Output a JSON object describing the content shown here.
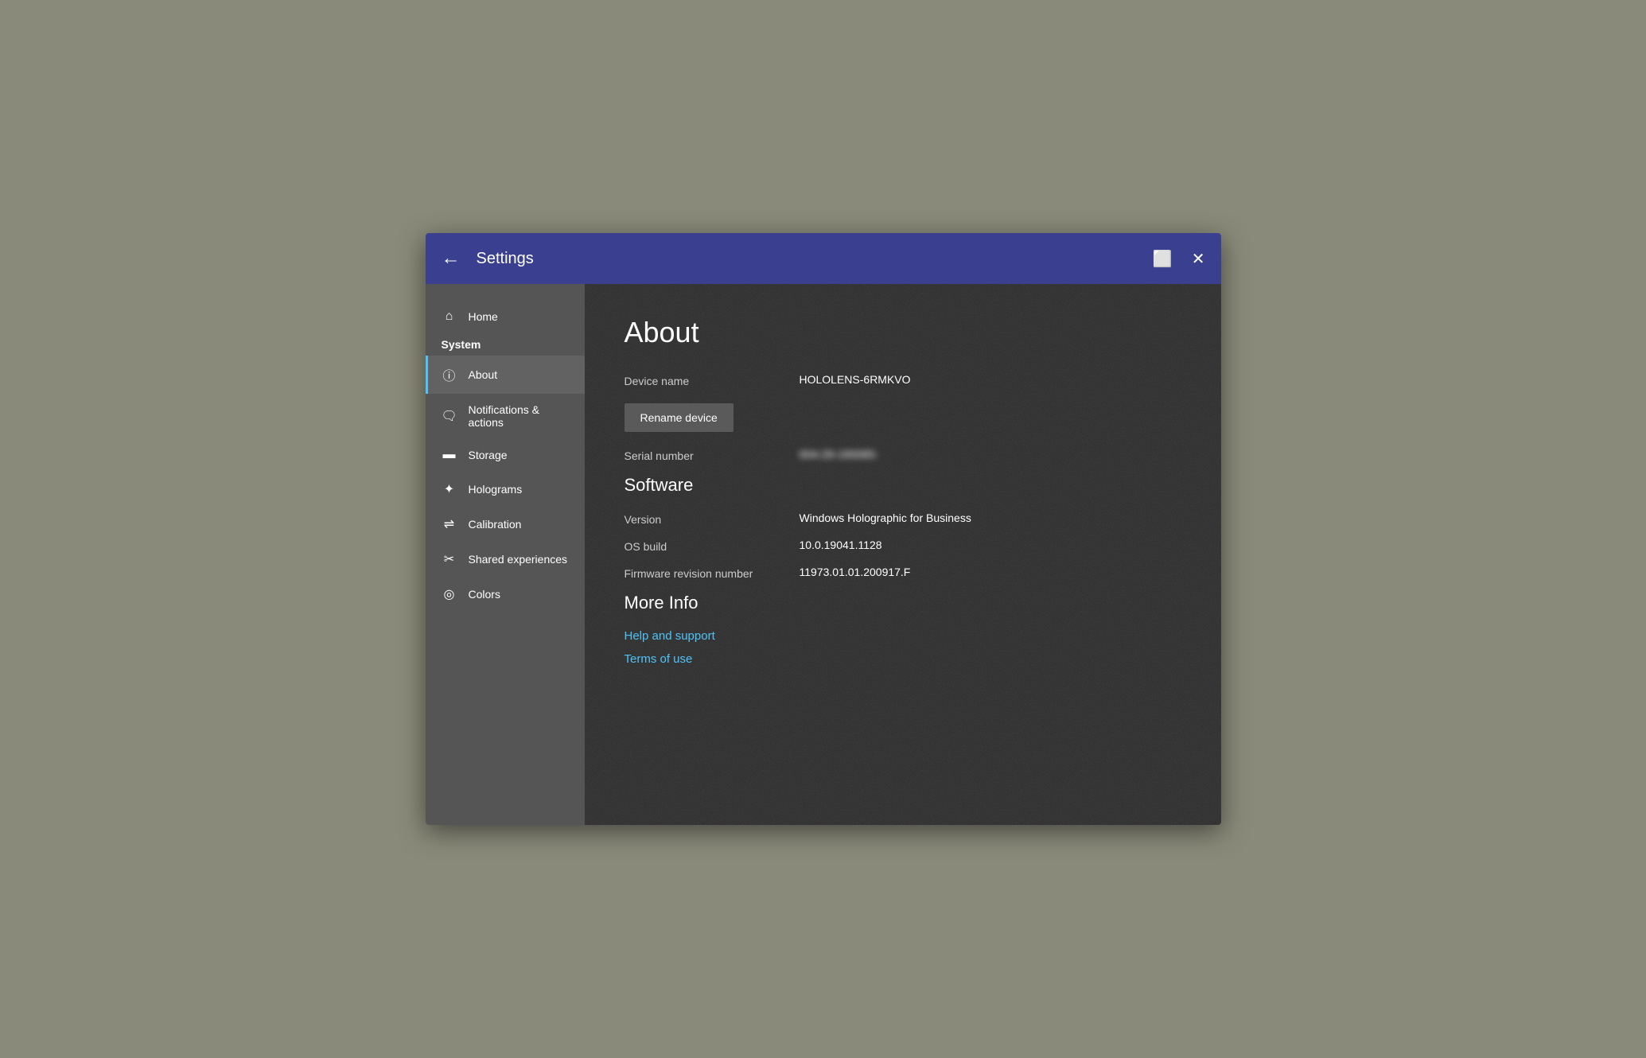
{
  "titlebar": {
    "back_label": "←",
    "title": "Settings",
    "window_icon": "⬜",
    "close_icon": "✕"
  },
  "sidebar": {
    "home_label": "Home",
    "system_label": "System",
    "items": [
      {
        "id": "about",
        "label": "About",
        "icon": "ℹ",
        "active": true
      },
      {
        "id": "notifications",
        "label": "Notifications & actions",
        "icon": "🗨",
        "active": false
      },
      {
        "id": "storage",
        "label": "Storage",
        "icon": "▭",
        "active": false
      },
      {
        "id": "holograms",
        "label": "Holograms",
        "icon": "✦",
        "active": false
      },
      {
        "id": "calibration",
        "label": "Calibration",
        "icon": "⇌",
        "active": false
      },
      {
        "id": "shared",
        "label": "Shared experiences",
        "icon": "⚙",
        "active": false
      },
      {
        "id": "colors",
        "label": "Colors",
        "icon": "◎",
        "active": false
      }
    ]
  },
  "content": {
    "page_title": "About",
    "device_name_label": "Device name",
    "device_name_value": "HOLOLENS-6RMKVO",
    "rename_btn_label": "Rename device",
    "serial_label": "Serial number",
    "serial_value": "004-29-190065-",
    "software_title": "Software",
    "version_label": "Version",
    "version_value": "Windows Holographic for Business",
    "os_build_label": "OS build",
    "os_build_value": "10.0.19041.1128",
    "firmware_label": "Firmware revision number",
    "firmware_value": "11973.01.01.200917.F",
    "more_info_title": "More Info",
    "help_link": "Help and support",
    "terms_link": "Terms of use"
  }
}
